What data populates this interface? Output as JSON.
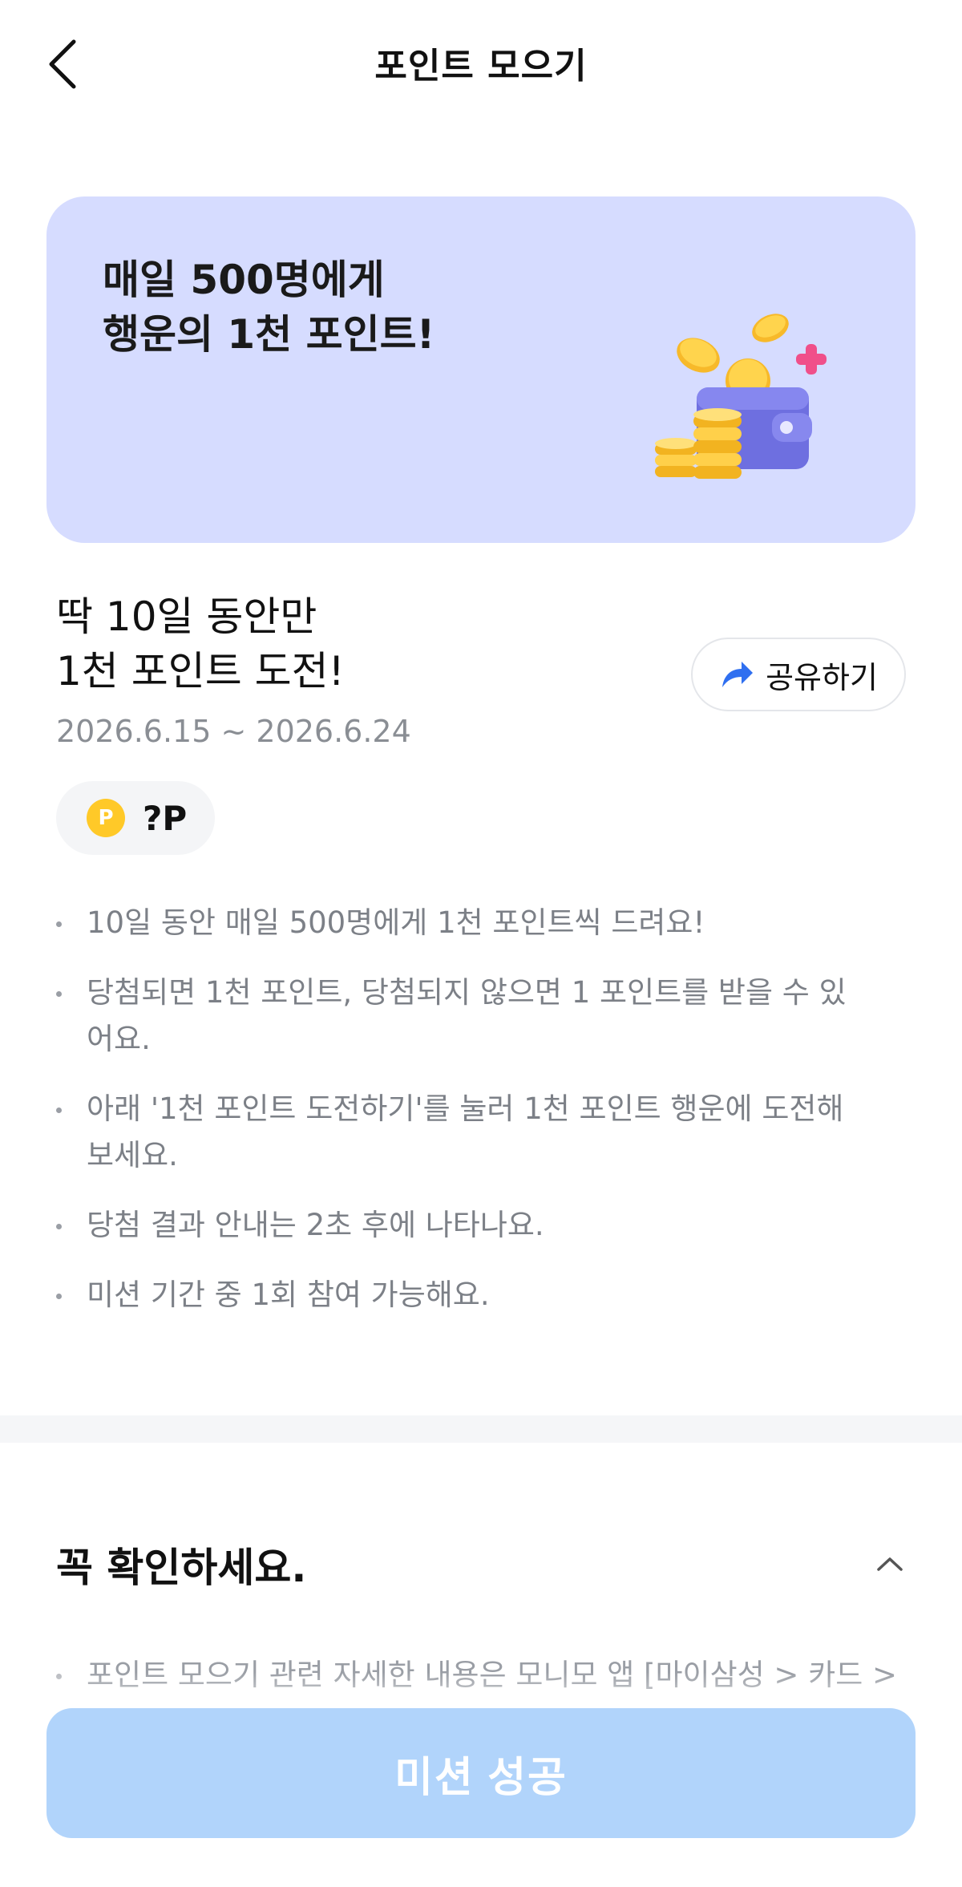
{
  "header": {
    "title": "포인트 모으기"
  },
  "banner": {
    "line1": "매일 500명에게",
    "line2": "행운의 1천 포인트!"
  },
  "mission": {
    "title_line1": "딱 10일 동안만",
    "title_line2": "1천 포인트 도전!",
    "date_range": "2026.6.15 ~ 2026.6.24",
    "share_label": "공유하기",
    "points_coin_symbol": "P",
    "points_value": "?P"
  },
  "notes": [
    "10일 동안 매일 500명에게 1천 포인트씩 드려요!",
    "당첨되면 1천 포인트, 당첨되지 않으면 1 포인트를 받을 수 있어요.",
    "아래 '1천 포인트 도전하기'를 눌러 1천 포인트 행운에 도전해 보세요.",
    "당첨 결과 안내는 2초 후에 나타나요.",
    "미션 기간 중 1회 참여 가능해요."
  ],
  "check_section": {
    "title": "꼭 확인하세요.",
    "items": [
      "포인트 모으기 관련 자세한 내용은 모니모 앱 [마이삼성 > 카드 >"
    ]
  },
  "cta": {
    "label": "미션 성공"
  },
  "colors": {
    "banner_bg": "#d6dcff",
    "cta_bg": "#b1d4fb",
    "share_icon": "#2f6ff0",
    "coin": "#ffc928"
  },
  "icons": {
    "back": "chevron-left-icon",
    "share": "share-arrow-icon",
    "coin": "point-coin-icon",
    "collapse": "chevron-up-icon",
    "banner": "wallet-coins-illustration"
  }
}
